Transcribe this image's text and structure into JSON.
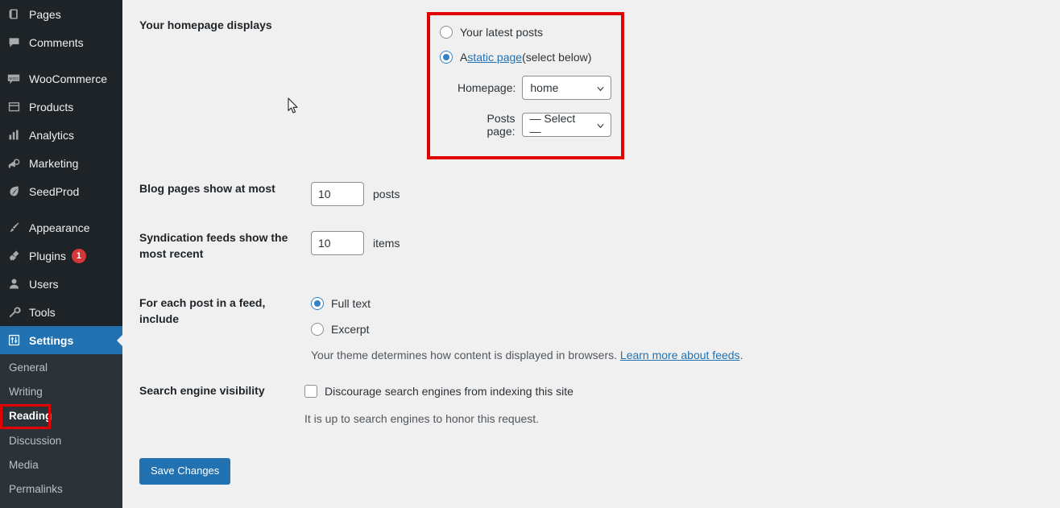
{
  "sidebar": {
    "items": [
      {
        "label": "Pages",
        "icon": "pages-icon",
        "badge": null
      },
      {
        "label": "Comments",
        "icon": "comments-icon",
        "badge": null
      },
      {
        "label": "WooCommerce",
        "icon": "woocommerce-icon",
        "badge": null
      },
      {
        "label": "Products",
        "icon": "products-icon",
        "badge": null
      },
      {
        "label": "Analytics",
        "icon": "analytics-icon",
        "badge": null
      },
      {
        "label": "Marketing",
        "icon": "marketing-icon",
        "badge": null
      },
      {
        "label": "SeedProd",
        "icon": "seedprod-icon",
        "badge": null
      },
      {
        "label": "Appearance",
        "icon": "appearance-icon",
        "badge": null
      },
      {
        "label": "Plugins",
        "icon": "plugins-icon",
        "badge": "1"
      },
      {
        "label": "Users",
        "icon": "users-icon",
        "badge": null
      },
      {
        "label": "Tools",
        "icon": "tools-icon",
        "badge": null
      },
      {
        "label": "Settings",
        "icon": "settings-icon",
        "badge": null
      }
    ],
    "submenu": [
      {
        "label": "General"
      },
      {
        "label": "Writing"
      },
      {
        "label": "Reading"
      },
      {
        "label": "Discussion"
      },
      {
        "label": "Media"
      },
      {
        "label": "Permalinks"
      }
    ],
    "active_item": "Settings",
    "active_subitem": "Reading",
    "accent_blue": "#2271b1",
    "badge_red": "#d63638",
    "highlight_red": "#e20000"
  },
  "settings": {
    "homepage_displays": {
      "label": "Your homepage displays",
      "option_latest": "Your latest posts",
      "option_static_prefix": "A ",
      "option_static_link": "static page",
      "option_static_suffix": " (select below)",
      "selected": "static",
      "homepage_label": "Homepage:",
      "homepage_value": "home",
      "posts_page_label": "Posts page:",
      "posts_page_value": "— Select —"
    },
    "blog_pages": {
      "label": "Blog pages show at most",
      "value": "10",
      "unit": "posts"
    },
    "syndication_feeds": {
      "label": "Syndication feeds show the most recent",
      "value": "10",
      "unit": "items"
    },
    "feed_include": {
      "label": "For each post in a feed, include",
      "option_full": "Full text",
      "option_excerpt": "Excerpt",
      "selected": "full",
      "description_prefix": "Your theme determines how content is displayed in browsers. ",
      "description_link": "Learn more about feeds",
      "description_suffix": "."
    },
    "search_visibility": {
      "label": "Search engine visibility",
      "checkbox_label": "Discourage search engines from indexing this site",
      "checked": false,
      "description": "It is up to search engines to honor this request."
    },
    "save_button": "Save Changes"
  }
}
